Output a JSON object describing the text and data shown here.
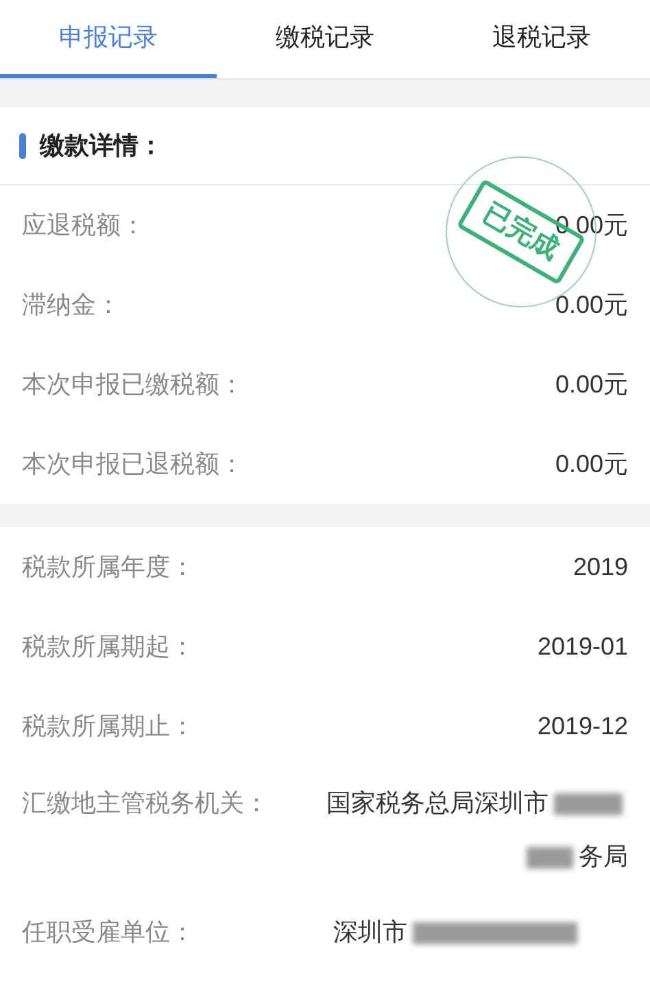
{
  "tabs": [
    {
      "label": "申报记录",
      "selected": true
    },
    {
      "label": "缴税记录",
      "selected": false
    },
    {
      "label": "退税记录",
      "selected": false
    }
  ],
  "payment_section": {
    "title": "缴款详情：",
    "stamp": "已完成",
    "rows": [
      {
        "label": "应退税额：",
        "value": "0.00元"
      },
      {
        "label": "滞纳金：",
        "value": "0.00元"
      },
      {
        "label": "本次申报已缴税额：",
        "value": "0.00元"
      },
      {
        "label": "本次申报已退税额：",
        "value": "0.00元"
      }
    ]
  },
  "tax_section": {
    "rows": [
      {
        "label": "税款所属年度：",
        "kind": "plain",
        "value": "2019"
      },
      {
        "label": "税款所属期起：",
        "kind": "plain",
        "value": "2019-01"
      },
      {
        "label": "税款所属期止：",
        "kind": "plain",
        "value": "2019-12"
      },
      {
        "label": "汇缴地主管税务机关：",
        "kind": "redacted",
        "lines": [
          "国家税务总局深圳市",
          "务局"
        ]
      },
      {
        "label": "任职受雇单位：",
        "kind": "redacted",
        "lines": [
          "深圳市"
        ]
      }
    ]
  }
}
